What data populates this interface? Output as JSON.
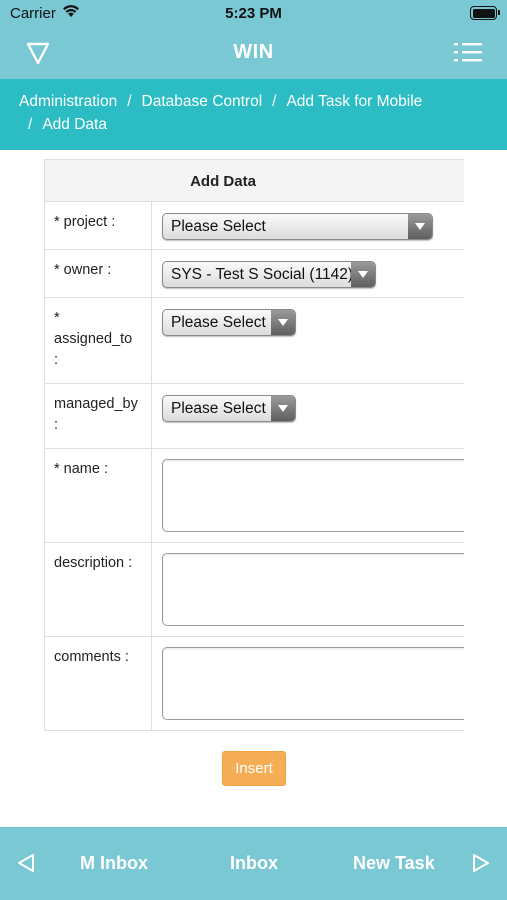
{
  "status": {
    "carrier": "Carrier",
    "time": "5:23 PM"
  },
  "nav": {
    "title": "WIN",
    "filter_icon": "filter-icon",
    "menu_icon": "list-menu-icon"
  },
  "breadcrumb": {
    "items": [
      "Administration",
      "Database Control",
      "Add Task for Mobile",
      "Add Data"
    ],
    "separator": "/"
  },
  "form": {
    "title": "Add Data",
    "fields": {
      "project": {
        "label": "* project :",
        "value": "Please Select"
      },
      "owner": {
        "label": "* owner :",
        "value": "SYS - Test S Social (1142)"
      },
      "assigned_to": {
        "label_lines": [
          "*",
          "assigned_to",
          ":"
        ],
        "value": "Please Select"
      },
      "managed_by": {
        "label_lines": [
          "managed_by",
          ":"
        ],
        "value": "Please Select"
      },
      "name": {
        "label": "* name :",
        "value": ""
      },
      "description": {
        "label": "description :",
        "value": ""
      },
      "comments": {
        "label": "comments :",
        "value": ""
      }
    },
    "insert_label": "Insert"
  },
  "tabs": {
    "items": [
      "M Inbox",
      "Inbox",
      "New Task"
    ]
  },
  "colors": {
    "bar": "#7ac8d4",
    "breadcrumb": "#2cbcc4",
    "insert": "#f6ae56"
  }
}
